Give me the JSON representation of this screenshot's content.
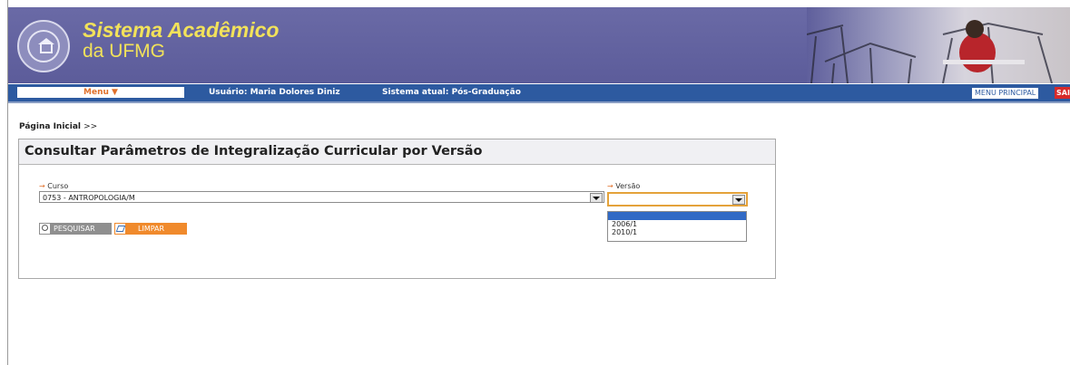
{
  "header": {
    "brand_line1": "Sistema Acadêmico",
    "brand_line2": "da UFMG",
    "banner_color": "#5c5c9a",
    "brand_color": "#f2e25a"
  },
  "menubar": {
    "menu_label": "Menu ▼",
    "user_text": "Usuário: Maria Dolores Diniz",
    "system_text": "Sistema atual: Pós-Graduação",
    "main_menu_label": "MENU PRINCIPAL",
    "exit_label": "SAIR",
    "bar_color": "#2d5aa0"
  },
  "breadcrumb": {
    "home_label": "Página Inicial",
    "separator": ">>"
  },
  "panel": {
    "title": "Consultar Parâmetros de Integralização Curricular por Versão",
    "curso": {
      "label": "Curso",
      "value": "0753 - ANTROPOLOGIA/M"
    },
    "versao": {
      "label": "Versão",
      "value": "",
      "options": [
        "",
        "2006/1",
        "2010/1"
      ]
    },
    "buttons": {
      "search_label": "PESQUISAR",
      "clear_label": "LIMPAR"
    }
  },
  "icons": {
    "seal": "university-seal-icon",
    "arrow": "arrow-right-icon",
    "dropdown": "chevron-down-icon",
    "search": "search-icon",
    "clear": "eraser-icon"
  },
  "accent_color": "#e0702a"
}
